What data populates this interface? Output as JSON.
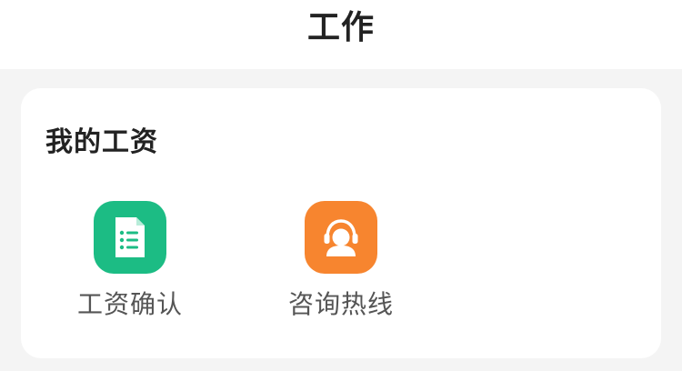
{
  "header": {
    "title": "工作"
  },
  "salary_card": {
    "title": "我的工资",
    "entries": [
      {
        "label": "工资确认",
        "icon": "document-list-icon",
        "icon_color": "#1cbc84"
      },
      {
        "label": "咨询热线",
        "icon": "customer-service-headset-icon",
        "icon_color": "#f7852f"
      }
    ]
  },
  "colors": {
    "page_background": "#f4f4f4",
    "card_background": "#ffffff",
    "title_text": "#222222",
    "label_text": "#555555"
  }
}
